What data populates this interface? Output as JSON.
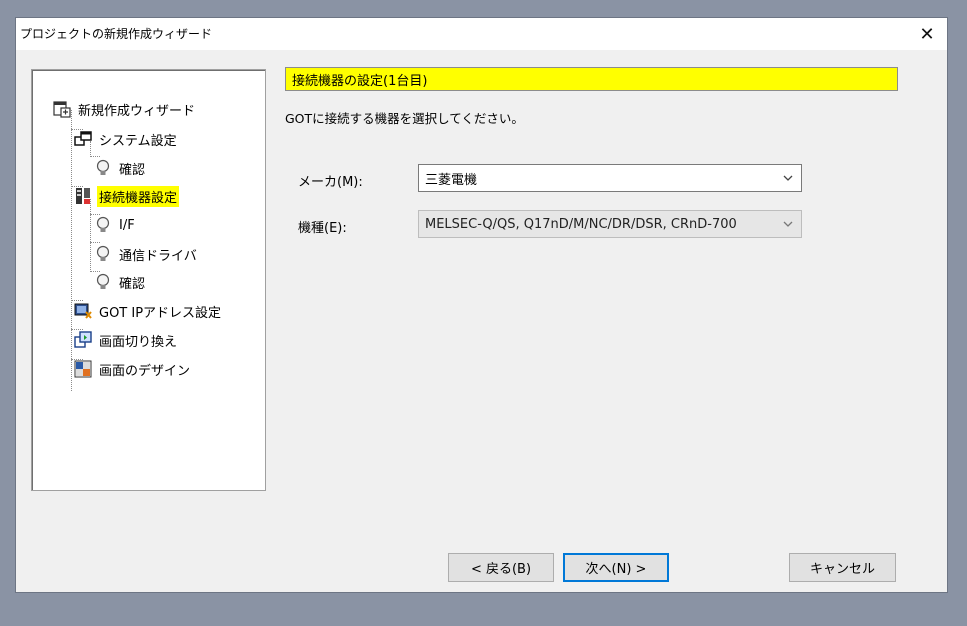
{
  "window": {
    "title": "プロジェクトの新規作成ウィザード",
    "close_glyph": "✕"
  },
  "tree": {
    "root": "新規作成ウィザード",
    "items": [
      {
        "label": "システム設定",
        "icon": "system-settings-icon"
      },
      {
        "label": "確認",
        "icon": "bulb-icon"
      },
      {
        "label": "接続機器設定",
        "icon": "connected-device-icon",
        "selected": true
      },
      {
        "label": "I/F",
        "icon": "bulb-icon"
      },
      {
        "label": "通信ドライバ",
        "icon": "bulb-icon"
      },
      {
        "label": "確認",
        "icon": "bulb-icon"
      },
      {
        "label": "GOT IPアドレス設定",
        "icon": "ip-address-icon"
      },
      {
        "label": "画面切り換え",
        "icon": "screen-switch-icon"
      },
      {
        "label": "画面のデザイン",
        "icon": "screen-design-icon"
      }
    ]
  },
  "main": {
    "header": "接続機器の設定(1台目)",
    "instruction": "GOTに接続する機器を選択してください。",
    "maker": {
      "label": "メーカ(M):",
      "value": "三菱電機"
    },
    "model": {
      "label": "機種(E):",
      "value": "MELSEC-Q/QS, Q17nD/M/NC/DR/DSR, CRnD-700"
    }
  },
  "buttons": {
    "back": "< 戻る(B)",
    "next": "次へ(N) >",
    "cancel": "キャンセル"
  },
  "colors": {
    "highlight": "#ffff00",
    "focus": "#0078d7"
  }
}
